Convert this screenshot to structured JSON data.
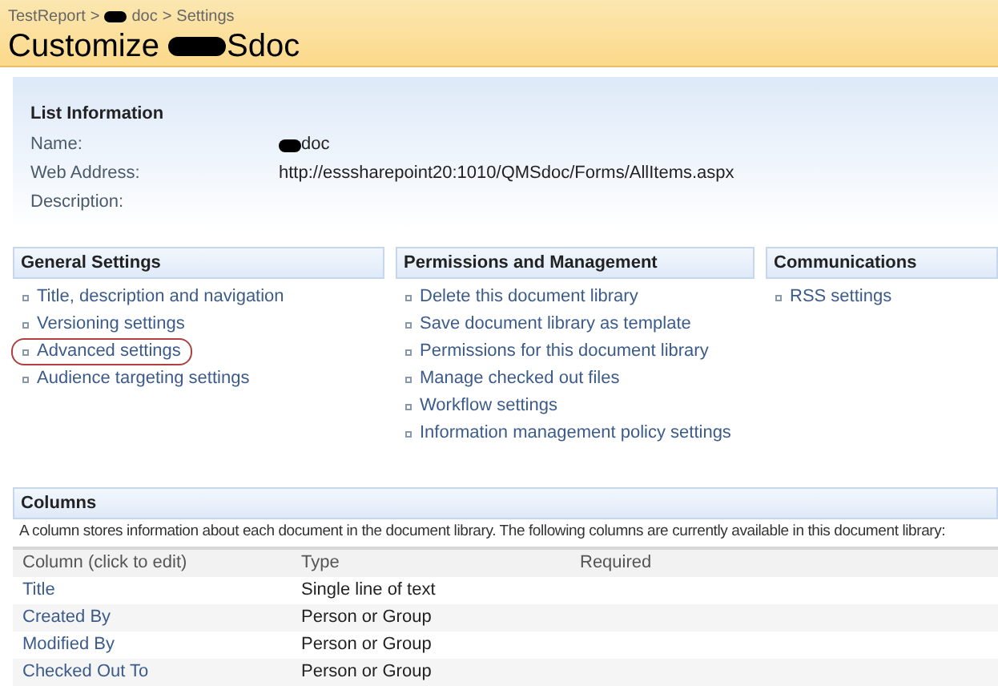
{
  "breadcrumb": {
    "items": [
      {
        "text": "TestReport",
        "redacted_after": false
      },
      {
        "text": "doc",
        "redacted_before": true
      },
      {
        "text": "Settings",
        "redacted_before": false
      }
    ],
    "separator": ">"
  },
  "title": {
    "prefix": "Customize",
    "suffix": "Sdoc"
  },
  "list_information": {
    "heading": "List Information",
    "fields": [
      {
        "label": "Name:",
        "value": "doc",
        "redacted": true
      },
      {
        "label": "Web Address:",
        "value": "http://esssharepoint20:1010/QMSdoc/Forms/AllItems.aspx",
        "redacted": false
      },
      {
        "label": "Description:",
        "redacted": false
      }
    ]
  },
  "sections": [
    {
      "heading": "General Settings",
      "links": [
        {
          "text": "Title, description and navigation",
          "highlighted": false
        },
        {
          "text": "Versioning settings",
          "highlighted": false
        },
        {
          "text": "Advanced settings",
          "highlighted": true
        },
        {
          "text": "Audience targeting settings",
          "highlighted": false
        }
      ]
    },
    {
      "heading": "Permissions and Management",
      "links": [
        {
          "text": "Delete this document library",
          "highlighted": false
        },
        {
          "text": "Save document library as template",
          "highlighted": false
        },
        {
          "text": "Permissions for this document library",
          "highlighted": false
        },
        {
          "text": "Manage checked out files",
          "highlighted": false
        },
        {
          "text": "Workflow settings",
          "highlighted": false
        },
        {
          "text": "Information management policy settings",
          "highlighted": false
        }
      ]
    },
    {
      "heading": "Communications",
      "links": [
        {
          "text": "RSS settings",
          "highlighted": false
        }
      ]
    }
  ],
  "columns": {
    "heading": "Columns",
    "description": "A column stores information about each document in the document library. The following columns are currently available in this document library:",
    "table": {
      "columns": [
        "Column (click to edit)",
        "Type",
        "Required"
      ],
      "rows": [
        {
          "name": "Title",
          "type": "Single line of text"
        },
        {
          "name": "Created By",
          "type": "Person or Group"
        },
        {
          "name": "Modified By",
          "type": "Person or Group"
        },
        {
          "name": "Checked Out To",
          "type": "Person or Group"
        }
      ]
    }
  }
}
